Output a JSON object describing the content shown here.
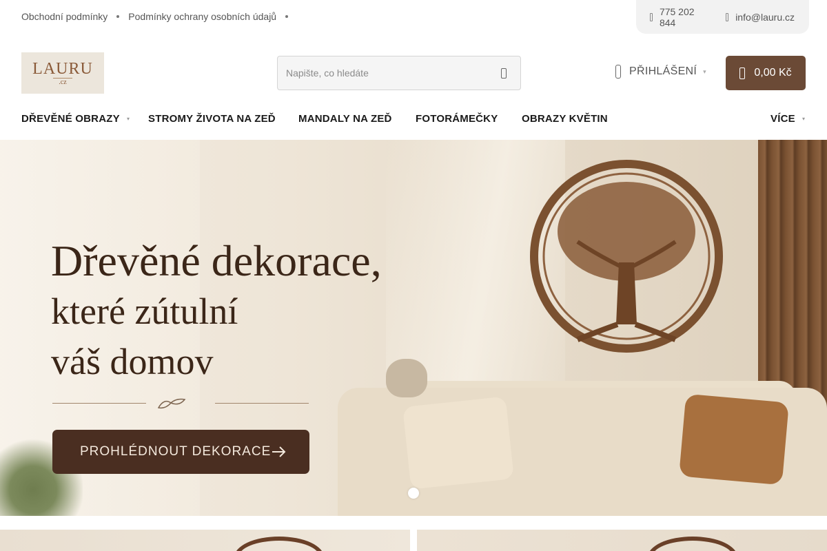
{
  "topbar": {
    "links": [
      "Obchodní podmínky",
      "Podmínky ochrany osobních údajů"
    ],
    "phone": "775 202 844",
    "email": "info@lauru.cz"
  },
  "header": {
    "logo_text": "LAURU",
    "logo_sub": ".cz",
    "search_placeholder": "Napište, co hledáte",
    "login_label": "PŘIHLÁŠENÍ",
    "cart_total": "0,00 Kč"
  },
  "nav": {
    "items": [
      "DŘEVĚNÉ OBRAZY",
      "STROMY ŽIVOTA NA ZEĎ",
      "MANDALY NA ZEĎ",
      "FOTORÁMEČKY",
      "OBRAZY KVĚTIN"
    ],
    "more_label": "VÍCE"
  },
  "hero": {
    "title_line1": "Dřevěné dekorace,",
    "title_line2": "které zútulní",
    "title_line3": "váš domov",
    "cta_label": "PROHLÉDNOUT DEKORACE"
  },
  "icons": {
    "phone": "phone-icon",
    "email": "email-icon",
    "search": "search-icon",
    "user": "user-icon",
    "cart": "cart-icon",
    "chevron": "chevron-down-icon",
    "arrow": "arrow-right-icon"
  },
  "colors": {
    "brand_brown": "#6b4a36",
    "cta_dark": "#4a2e21",
    "text_dark": "#1a1a1a"
  }
}
